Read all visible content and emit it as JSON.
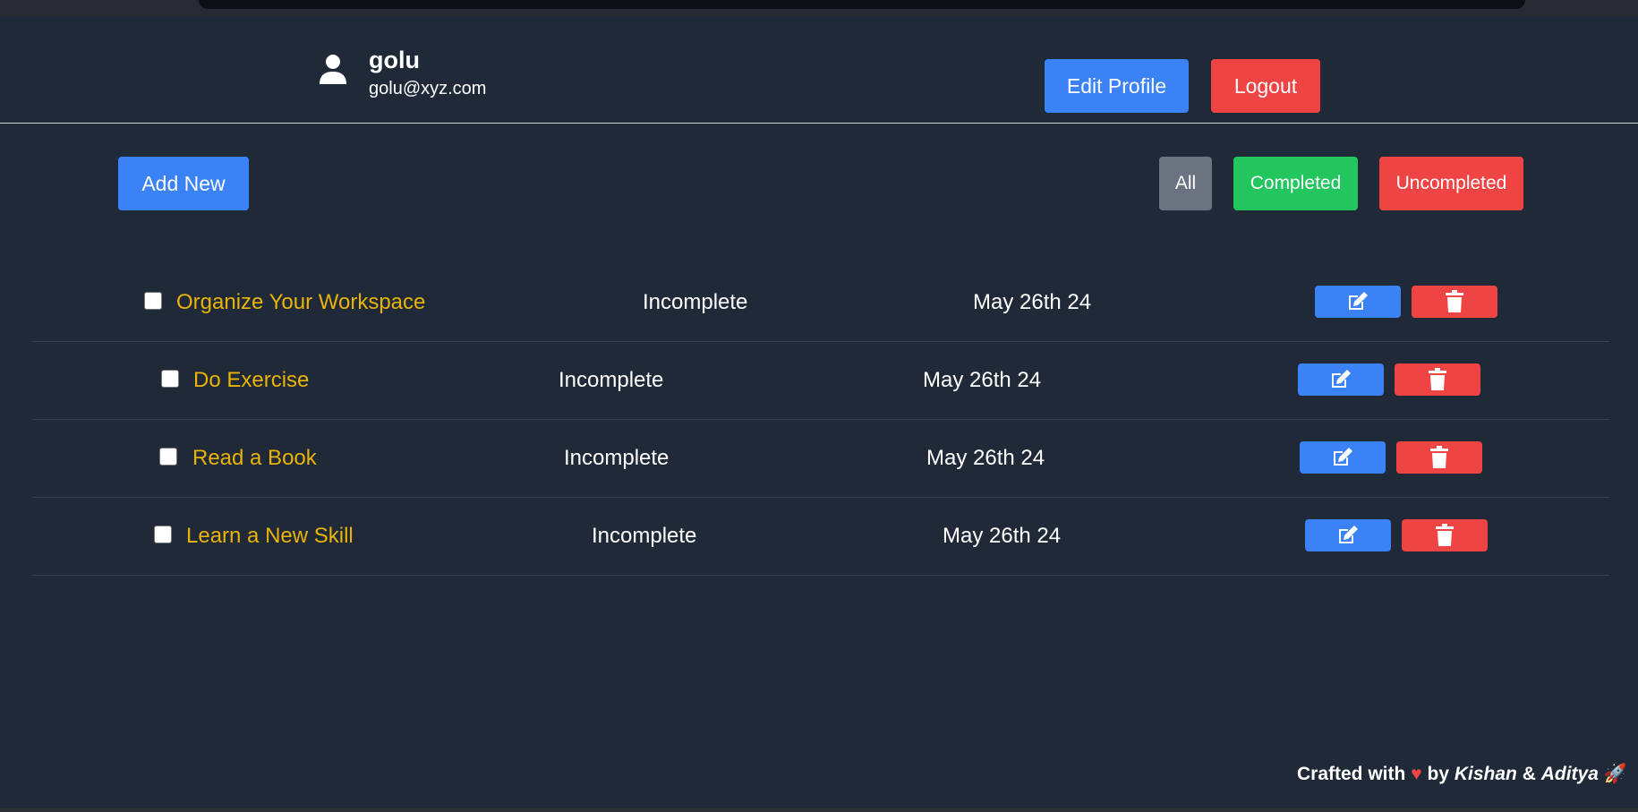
{
  "user": {
    "name": "golu",
    "email": "golu@xyz.com"
  },
  "header": {
    "edit_profile_label": "Edit Profile",
    "logout_label": "Logout"
  },
  "toolbar": {
    "add_new_label": "Add New",
    "filters": {
      "all": "All",
      "completed": "Completed",
      "uncompleted": "Uncompleted"
    }
  },
  "tasks": [
    {
      "title": "Organize Your Workspace",
      "status": "Incomplete",
      "date": "May 26th 24",
      "checked": false
    },
    {
      "title": "Do Exercise",
      "status": "Incomplete",
      "date": "May 26th 24",
      "checked": false
    },
    {
      "title": "Read a Book",
      "status": "Incomplete",
      "date": "May 26th 24",
      "checked": false
    },
    {
      "title": "Learn a New Skill",
      "status": "Incomplete",
      "date": "May 26th 24",
      "checked": false
    }
  ],
  "footer": {
    "crafted_with": "Crafted with",
    "heart": "♥",
    "by": "by",
    "author1": "Kishan",
    "amp": "&",
    "author2": "Aditya",
    "rocket": "🚀"
  },
  "colors": {
    "background": "#1f2937",
    "primary": "#3b82f6",
    "danger": "#ef4444",
    "success": "#22c55e",
    "neutral": "#6b7280",
    "task_title": "#eab308"
  },
  "icons": {
    "user": "user-icon",
    "edit": "edit-icon",
    "delete": "trash-icon"
  }
}
